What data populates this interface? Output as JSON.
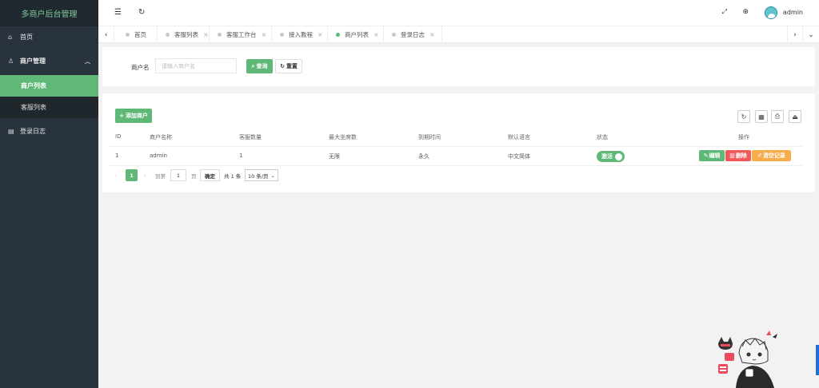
{
  "sidebar": {
    "logo": "多商户后台管理",
    "items": [
      {
        "icon": "home-icon",
        "label": "首页"
      },
      {
        "icon": "user-icon",
        "label": "商户管理"
      },
      {
        "label": "商户列表"
      },
      {
        "label": "客服列表"
      },
      {
        "icon": "calendar-icon",
        "label": "登录日志"
      }
    ]
  },
  "header": {
    "username": "admin"
  },
  "tabs": [
    {
      "label": "首页"
    },
    {
      "label": "客服列表"
    },
    {
      "label": "客服工作台"
    },
    {
      "label": "接入教程"
    },
    {
      "label": "商户列表"
    },
    {
      "label": "登录日志"
    }
  ],
  "search": {
    "label": "商户名",
    "placeholder": "请输入商户名",
    "query_button": "查询",
    "reset_button": "重置"
  },
  "toolbar": {
    "add_button": "添加商户"
  },
  "table": {
    "columns": [
      "ID",
      "商户名称",
      "客服数量",
      "最大坐席数",
      "到期时间",
      "默认语言",
      "状态",
      "操作"
    ],
    "rows": [
      {
        "id": "1",
        "name": "admin",
        "agents": "1",
        "max_seats": "无限",
        "expiry": "永久",
        "language": "中文简体",
        "status": "激活",
        "actions": [
          "编辑",
          "删除",
          "清空记录"
        ]
      }
    ]
  },
  "pagination": {
    "current_page": "1",
    "goto_prefix": "到第",
    "goto_value": "1",
    "goto_suffix": "页",
    "confirm": "确定",
    "total": "共 1 条",
    "page_size": "10 条/页"
  },
  "colors": {
    "accent": "#5fb878",
    "sidebar": "#28333e",
    "danger": "#ff5722",
    "warning": "#ffb800"
  }
}
